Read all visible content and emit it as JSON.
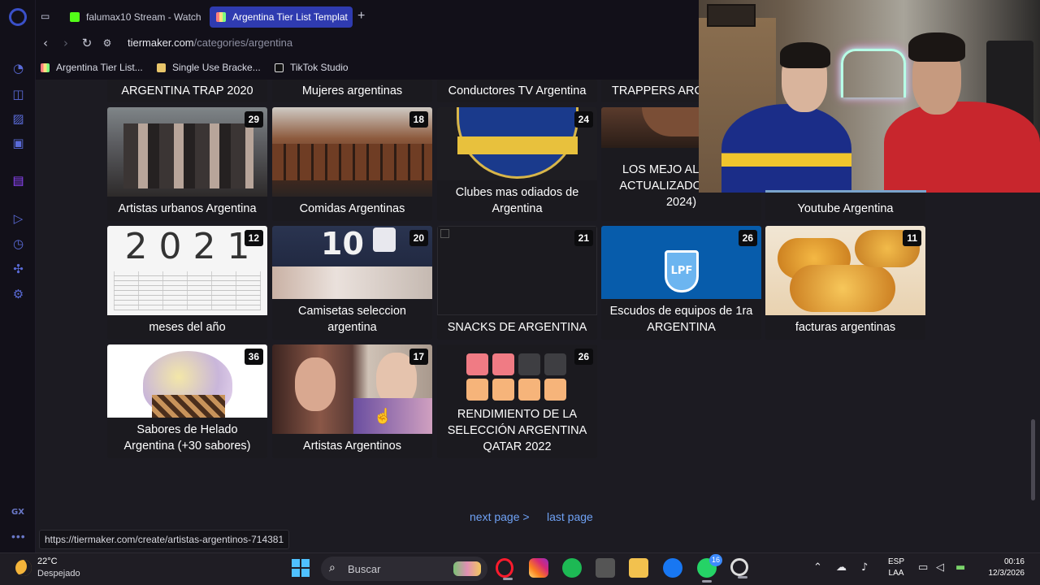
{
  "browser": {
    "tabs": [
      {
        "label": "falumax10 Stream - Watch"
      },
      {
        "label": "Argentina Tier List Templat"
      }
    ],
    "url": {
      "host": "tiermaker.com",
      "path": "/categories/argentina"
    },
    "bookmarks": [
      {
        "label": "Argentina Tier List..."
      },
      {
        "label": "Single Use Bracke..."
      },
      {
        "label": "TikTok Studio"
      }
    ],
    "sidebar_icons": [
      "speed-dial-icon",
      "bag-icon",
      "flow-icon",
      "gx-corner-icon",
      "twitch-icon",
      "player-icon",
      "history-icon",
      "extensions-icon",
      "settings-icon"
    ],
    "sidebar_gx": "GX",
    "sidebar_more": "•••"
  },
  "tiles": [
    {
      "title": "ARGENTINA TRAP 2020"
    },
    {
      "title": "Mujeres argentinas"
    },
    {
      "title": "Conductores TV Argentina"
    },
    {
      "title": "TRAPPERS ARG"
    },
    {
      "title": "Artistas urbanos Argentina",
      "count": "29"
    },
    {
      "title": "Comidas Argentinas",
      "count": "18"
    },
    {
      "title": "Clubes mas odiados de Argentina",
      "count": "24"
    },
    {
      "title": "LOS MEJO ALFAJORI ACTUALIZADO (ABRIL 2024)",
      "count": ""
    },
    {
      "title": "Youtube Argentina",
      "count": ""
    },
    {
      "title": "meses del año",
      "count": "12",
      "thumb_text": "2 0 2 1"
    },
    {
      "title": "Camisetas seleccion argentina",
      "count": "20",
      "thumb_text": "10"
    },
    {
      "title": "SNACKS DE ARGENTINA",
      "count": "21"
    },
    {
      "title": "Escudos de equipos de 1ra ARGENTINA",
      "count": "26",
      "thumb_text": "LPF"
    },
    {
      "title": "facturas argentinas",
      "count": "11"
    },
    {
      "title": "Sabores de Helado Argentina (+30 sabores)",
      "count": "36"
    },
    {
      "title": "Artistas Argentinos",
      "count": "17"
    },
    {
      "title": "RENDIMIENTO DE LA SELECCIÓN ARGENTINA QATAR 2022",
      "count": "26"
    }
  ],
  "pagination": {
    "next": "next page >",
    "last": "last page"
  },
  "status_url": "https://tiermaker.com/create/artistas-argentinos-714381",
  "taskbar": {
    "temperature": "22°C",
    "weather": "Despejado",
    "search_placeholder": "Buscar",
    "whatsapp_badge": "16",
    "lang_line1": "ESP",
    "lang_line2": "LAA",
    "time": "00:16",
    "date": "12/3/2026"
  },
  "colors": {
    "accent_tab": "#2f3bb0",
    "link": "#6fa2f5",
    "page_bg": "#1c1b22",
    "card_bg": "#1b1a1f"
  }
}
